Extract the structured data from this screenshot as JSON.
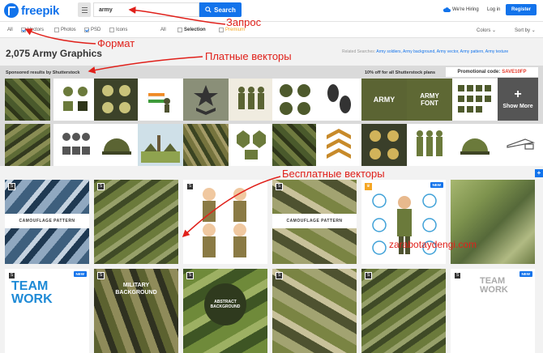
{
  "header": {
    "logo": "freepik",
    "search_value": "army",
    "search_button": "Search",
    "hiring": "We're Hiring",
    "login": "Log in",
    "register": "Register"
  },
  "filters": {
    "all_left": "All",
    "vectors": "Vectors",
    "photos": "Photos",
    "psd": "PSD",
    "icons": "Icons",
    "all_right": "All",
    "selection": "Selection",
    "premium": "Premium",
    "colors": "Colors",
    "sort": "Sort by"
  },
  "results": {
    "count": "2,075 Army Graphics",
    "related_label": "Related Searches:",
    "related": "Army soldiers, Army background, Army vector, Army pattern, Army texture"
  },
  "sponsor": {
    "label": "Sponsored results by Shutterstock",
    "offer": "10% off for all Shutterstock plans",
    "promo_label": "Promotional code:",
    "promo_code": "SAVE10FP",
    "show_more": "Show More",
    "tile_army_text": "ARMY",
    "tile_font_text": "ARMY FONT"
  },
  "grid": {
    "camo_title": "CAMOUFLAGE PATTERN",
    "new_badge": "NEW",
    "team_work": "TEAM WORK",
    "team_work_2": "TEAM WORK",
    "military": "MILITARY BACKGROUND",
    "abstract": "ABSTRACT BACKGROUND"
  },
  "annotations": {
    "query": "Запрос",
    "format": "Формат",
    "paid": "Платные векторы",
    "free": "Бесплатные векторы",
    "watermark": "zarabotaydengi.com"
  },
  "colors": {
    "brand": "#1273eb",
    "annotation": "#e0201a",
    "promo": "#e53b2c"
  }
}
